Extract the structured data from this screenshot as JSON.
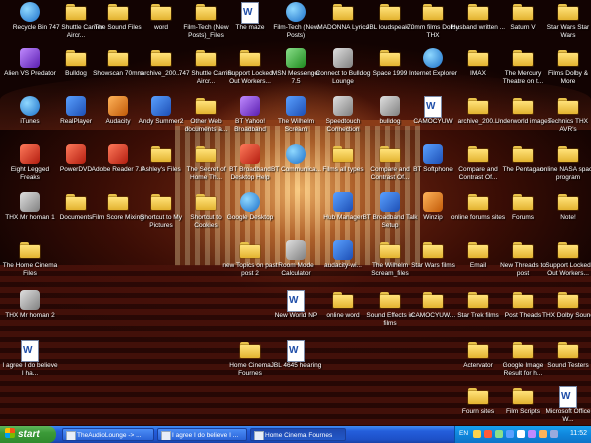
{
  "desktop": {
    "icons": [
      {
        "label": "Recycle Bin",
        "icon": "recycle-bin-icon",
        "type": "round"
      },
      {
        "label": "747 Shuttle Carrier Aircr...",
        "icon": "folder-icon",
        "type": "folder"
      },
      {
        "label": "The Sound Files",
        "icon": "folder-icon",
        "type": "folder"
      },
      {
        "label": "word",
        "icon": "folder-icon",
        "type": "folder"
      },
      {
        "label": "Film-Tech (New Posts)_Files",
        "icon": "folder-icon",
        "type": "folder"
      },
      {
        "label": "The maze",
        "icon": "word-document-icon",
        "type": "doc"
      },
      {
        "label": "Film-Tech (New Posts)",
        "icon": "internet-shortcut-icon",
        "type": "round"
      },
      {
        "label": "MADONNA Lyrics",
        "icon": "folder-icon",
        "type": "folder"
      },
      {
        "label": "JBL loudspeak...",
        "icon": "folder-icon",
        "type": "folder"
      },
      {
        "label": "70mm films Dolby THX",
        "icon": "folder-icon",
        "type": "folder"
      },
      {
        "label": "Husband written ...",
        "icon": "folder-icon",
        "type": "folder"
      },
      {
        "label": "Saturn V",
        "icon": "folder-icon",
        "type": "folder"
      },
      {
        "label": "Star Wars Star Wars",
        "icon": "folder-icon",
        "type": "folder"
      },
      {
        "label": "Alien VS Predator",
        "icon": "application-icon",
        "type": "app purple"
      },
      {
        "label": "Bulldog",
        "icon": "folder-icon",
        "type": "folder"
      },
      {
        "label": "Showscan 70mm",
        "icon": "folder-icon",
        "type": "folder"
      },
      {
        "label": "archive_200...",
        "icon": "folder-icon",
        "type": "folder"
      },
      {
        "label": "747 Shuttle Carrier Aircr...",
        "icon": "folder-icon",
        "type": "folder"
      },
      {
        "label": "Support Locked Out Workers...",
        "icon": "folder-icon",
        "type": "folder"
      },
      {
        "label": "MSN Messenger 7.5",
        "icon": "msn-messenger-icon",
        "type": "app green"
      },
      {
        "label": "Connect to Bulldog Lounge",
        "icon": "network-connection-icon",
        "type": "app gray"
      },
      {
        "label": "Space 1999",
        "icon": "folder-icon",
        "type": "folder"
      },
      {
        "label": "Internet Explorer",
        "icon": "internet-explorer-icon",
        "type": "round"
      },
      {
        "label": "IMAX",
        "icon": "folder-icon",
        "type": "folder"
      },
      {
        "label": "The Mercury Theatre on t...",
        "icon": "folder-icon",
        "type": "folder"
      },
      {
        "label": "Films Dolby & More",
        "icon": "folder-icon",
        "type": "folder"
      },
      {
        "label": "iTunes",
        "icon": "itunes-icon",
        "type": "round"
      },
      {
        "label": "RealPlayer",
        "icon": "realplayer-icon",
        "type": "app"
      },
      {
        "label": "Audacity",
        "icon": "audacity-icon",
        "type": "app orange"
      },
      {
        "label": "Andy Summer2",
        "icon": "media-icon",
        "type": "app"
      },
      {
        "label": "Other Web documents a...",
        "icon": "folder-icon",
        "type": "folder"
      },
      {
        "label": "BT Yahoo! Broadband",
        "icon": "bt-yahoo-icon",
        "type": "app purple"
      },
      {
        "label": "The Wilhelm Scream",
        "icon": "media-icon",
        "type": "app"
      },
      {
        "label": "Speedtouch Connection",
        "icon": "network-connection-icon",
        "type": "app gray"
      },
      {
        "label": "bulldog",
        "icon": "network-connection-icon",
        "type": "app gray"
      },
      {
        "label": "CAMOCYUW",
        "icon": "word-document-icon",
        "type": "doc"
      },
      {
        "label": "archive_200...",
        "icon": "folder-icon",
        "type": "folder"
      },
      {
        "label": "Underworld images",
        "icon": "folder-icon",
        "type": "folder"
      },
      {
        "label": "Technics THX AVR's",
        "icon": "folder-icon",
        "type": "folder"
      },
      {
        "label": "Eight Legged Freaks",
        "icon": "media-icon",
        "type": "app red"
      },
      {
        "label": "PowerDVD",
        "icon": "powerdvd-icon",
        "type": "app red"
      },
      {
        "label": "Adobe Reader 7.0",
        "icon": "adobe-reader-icon",
        "type": "app red"
      },
      {
        "label": "Ashley's Files",
        "icon": "folder-icon",
        "type": "folder"
      },
      {
        "label": "The Secret of Home Th...",
        "icon": "folder-icon",
        "type": "folder"
      },
      {
        "label": "BT Broadband Desktop Help",
        "icon": "help-icon",
        "type": "app red"
      },
      {
        "label": "BT Communica...",
        "icon": "bt-communicator-icon",
        "type": "round"
      },
      {
        "label": "Films all types",
        "icon": "folder-icon",
        "type": "folder"
      },
      {
        "label": "Compare and Contrast Of...",
        "icon": "folder-icon",
        "type": "folder"
      },
      {
        "label": "BT Softphone",
        "icon": "phone-icon",
        "type": "app"
      },
      {
        "label": "Compare and Contrast Of...",
        "icon": "folder-icon",
        "type": "folder"
      },
      {
        "label": "The Pentagan",
        "icon": "folder-icon",
        "type": "folder"
      },
      {
        "label": "online NASA space program",
        "icon": "folder-icon",
        "type": "folder"
      },
      {
        "label": "THX Mr homan 1",
        "icon": "media-icon",
        "type": "app gray"
      },
      {
        "label": "Documents",
        "icon": "folder-icon",
        "type": "folder"
      },
      {
        "label": "Film Score Mixing",
        "icon": "folder-icon",
        "type": "folder"
      },
      {
        "label": "Shortcut to My Pictures",
        "icon": "folder-icon",
        "type": "folder"
      },
      {
        "label": "Shortcut to Cookies",
        "icon": "folder-icon",
        "type": "folder"
      },
      {
        "label": "Google Desktop",
        "icon": "google-desktop-icon",
        "type": "round"
      },
      {
        "label": "Hub Manager",
        "icon": "network-icon",
        "type": "app"
      },
      {
        "label": "BT Broadband Talk Setup",
        "icon": "phone-icon",
        "type": "app"
      },
      {
        "label": "Winzip",
        "icon": "winzip-icon",
        "type": "app orange"
      },
      {
        "label": "online forums sites",
        "icon": "folder-icon",
        "type": "folder"
      },
      {
        "label": "Forums",
        "icon": "folder-icon",
        "type": "folder"
      },
      {
        "label": "Note!",
        "icon": "folder-icon",
        "type": "folder"
      },
      {
        "label": "The Home Cinema Files",
        "icon": "folder-icon",
        "type": "folder"
      },
      {
        "label": "new Topics on past post 2",
        "icon": "folder-icon",
        "type": "folder"
      },
      {
        "label": "Room Mode Calculator",
        "icon": "calculator-icon",
        "type": "app gray"
      },
      {
        "label": "audacity-wi...",
        "icon": "audacity-icon",
        "type": "app"
      },
      {
        "label": "The Wilhelm Scream_files",
        "icon": "folder-icon",
        "type": "folder"
      },
      {
        "label": "Star Wars films",
        "icon": "folder-icon",
        "type": "folder"
      },
      {
        "label": "Email",
        "icon": "folder-icon",
        "type": "folder"
      },
      {
        "label": "New Threads to post",
        "icon": "folder-icon",
        "type": "folder"
      },
      {
        "label": "Support Locked Out Workers...",
        "icon": "folder-icon",
        "type": "folder"
      },
      {
        "label": "THX Mr homan 2",
        "icon": "media-icon",
        "type": "app gray"
      },
      {
        "label": "New World NP",
        "icon": "word-document-icon",
        "type": "doc"
      },
      {
        "label": "online word",
        "icon": "folder-icon",
        "type": "folder"
      },
      {
        "label": "Sound Effects in films",
        "icon": "folder-icon",
        "type": "folder"
      },
      {
        "label": "CAMOCYUW...",
        "icon": "folder-icon",
        "type": "folder"
      },
      {
        "label": "Star Trek films",
        "icon": "folder-icon",
        "type": "folder"
      },
      {
        "label": "Post Theads",
        "icon": "folder-icon",
        "type": "folder"
      },
      {
        "label": "THX Dolby Sound",
        "icon": "folder-icon",
        "type": "folder"
      },
      {
        "label": "I agree I do believe I ha...",
        "icon": "word-document-icon",
        "type": "doc"
      },
      {
        "label": "Home Cinema Fournes",
        "icon": "folder-icon",
        "type": "folder"
      },
      {
        "label": "JBL 4645 hearing",
        "icon": "word-document-icon",
        "type": "doc"
      },
      {
        "label": "Actervator",
        "icon": "folder-icon",
        "type": "folder"
      },
      {
        "label": "Google Image Result for h...",
        "icon": "folder-icon",
        "type": "folder"
      },
      {
        "label": "Sound Testers",
        "icon": "folder-icon",
        "type": "folder"
      },
      {
        "label": "Fourn sites",
        "icon": "folder-icon",
        "type": "folder"
      },
      {
        "label": "Film Scripts",
        "icon": "folder-icon",
        "type": "folder"
      },
      {
        "label": "Microsoft Office W...",
        "icon": "word-document-icon",
        "type": "doc"
      }
    ]
  },
  "taskbar": {
    "start_label": "start",
    "tasks": [
      {
        "label": "TheAudioLounge -> ..."
      },
      {
        "label": "I agree I do believe I ..."
      },
      {
        "label": "Home Cinema Fournes"
      }
    ],
    "tray_lang": "EN",
    "clock": "11:52"
  }
}
